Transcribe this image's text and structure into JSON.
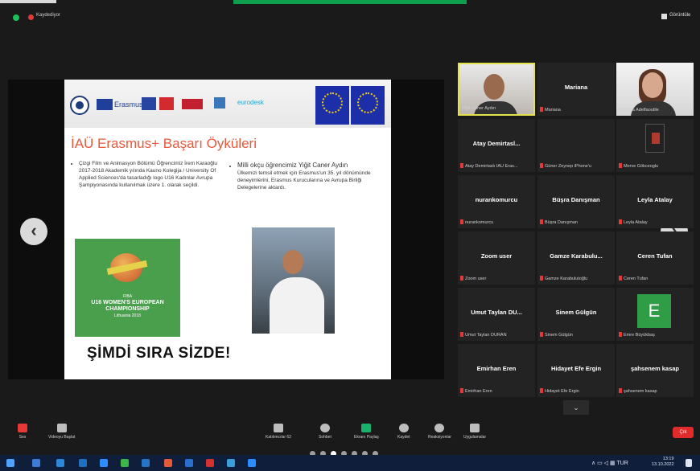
{
  "topbar": {
    "recording_label": "Kaydediyor",
    "view_label": "Görüntüle"
  },
  "slide": {
    "logos": {
      "erasmus_text": "Erasmus+",
      "eurodesk_text": "eurodesk"
    },
    "title": "İAÜ Erasmus+ Başarı Öyküleri",
    "column1_text": "Çizgi Film ve Animasyon Bölümü Öğrencimiz İrem Karaoğlu 2017-2018 Akademik yılında Kauno Kolegija / University Of Applied Sciences'da tasarladığı logo U16 Kadınlar Avrupa Şampiyonasında kullanılmak üzere 1. olarak seçildi.",
    "column2_lead": "Milli okçu öğrencimiz Yiğit Caner Aydın",
    "column2_text": "Ülkemizi temsil etmek için Erasmus'un 35. yıl dönümünde deneyimlerini, Erasmus Kurucularına ve Avrupa Birliği Delegelerine aktardı.",
    "fiba_line1": "FIBA",
    "fiba_line2": "U16 WOMEN'S EUROPEAN",
    "fiba_line3": "CHAMPIONSHIP",
    "fiba_line4": "Lithuania 2018",
    "slogan": "ŞİMDİ SIRA SİZDE!"
  },
  "gallery": {
    "tiles": [
      {
        "name": "",
        "caption": "Yiğit Caner Aydın"
      },
      {
        "name": "Mariana",
        "caption": "Mariana"
      },
      {
        "name": "",
        "caption": "Mariana Adelfaoutile"
      },
      {
        "name": "Atay Demirtasl...",
        "caption": "Atay Demirtaslı IAU Eras..."
      },
      {
        "name": "",
        "caption": "Güner Zeynep iPhone'u"
      },
      {
        "name": "",
        "caption": "Merve Gökceoglu"
      },
      {
        "name": "nurankomurcu",
        "caption": "nurankomurcu"
      },
      {
        "name": "Büşra Danışman",
        "caption": "Büşra Danışman"
      },
      {
        "name": "Leyla Atalay",
        "caption": "Leyla Atalay"
      },
      {
        "name": "Zoom user",
        "caption": "Zoom user"
      },
      {
        "name": "Gamze Karabulu...",
        "caption": "Gamze Karabulutoğlu"
      },
      {
        "name": "Ceren Tufan",
        "caption": "Ceren Tufan"
      },
      {
        "name": "Umut Taylan DU...",
        "caption": "Umut Taylan DURAN"
      },
      {
        "name": "Sinem Gülgün",
        "caption": "Sinem Gülgün"
      },
      {
        "name": "E",
        "caption": "Emre Büyükbaş"
      },
      {
        "name": "Emirhan Eren",
        "caption": "Emirhan Eren"
      },
      {
        "name": "Hidayet Efe Ergin",
        "caption": "Hidayet Efe Ergin"
      },
      {
        "name": "şahsenem kasap",
        "caption": "şahsenem kasap"
      }
    ]
  },
  "toolbar": {
    "mute_label": "Ses",
    "video_label": "Videoyu Başlat",
    "participants_label": "Katılımcılar",
    "participants_count": "62",
    "chat_label": "Sohbet",
    "share_label": "Ekranı Paylaş",
    "record_label": "Kaydet",
    "reactions_label": "Reaksiyonlar",
    "apps_label": "Uygulamalar",
    "leave_label": "Çık"
  },
  "taskbar": {
    "time": "13:19",
    "date": "13.10.2022",
    "lang": "TUR"
  },
  "colors": {
    "accent_green": "#0e9f4e",
    "slide_title": "#e8583b",
    "leave_red": "#e02b2b",
    "active_speaker": "#e3e24a"
  }
}
